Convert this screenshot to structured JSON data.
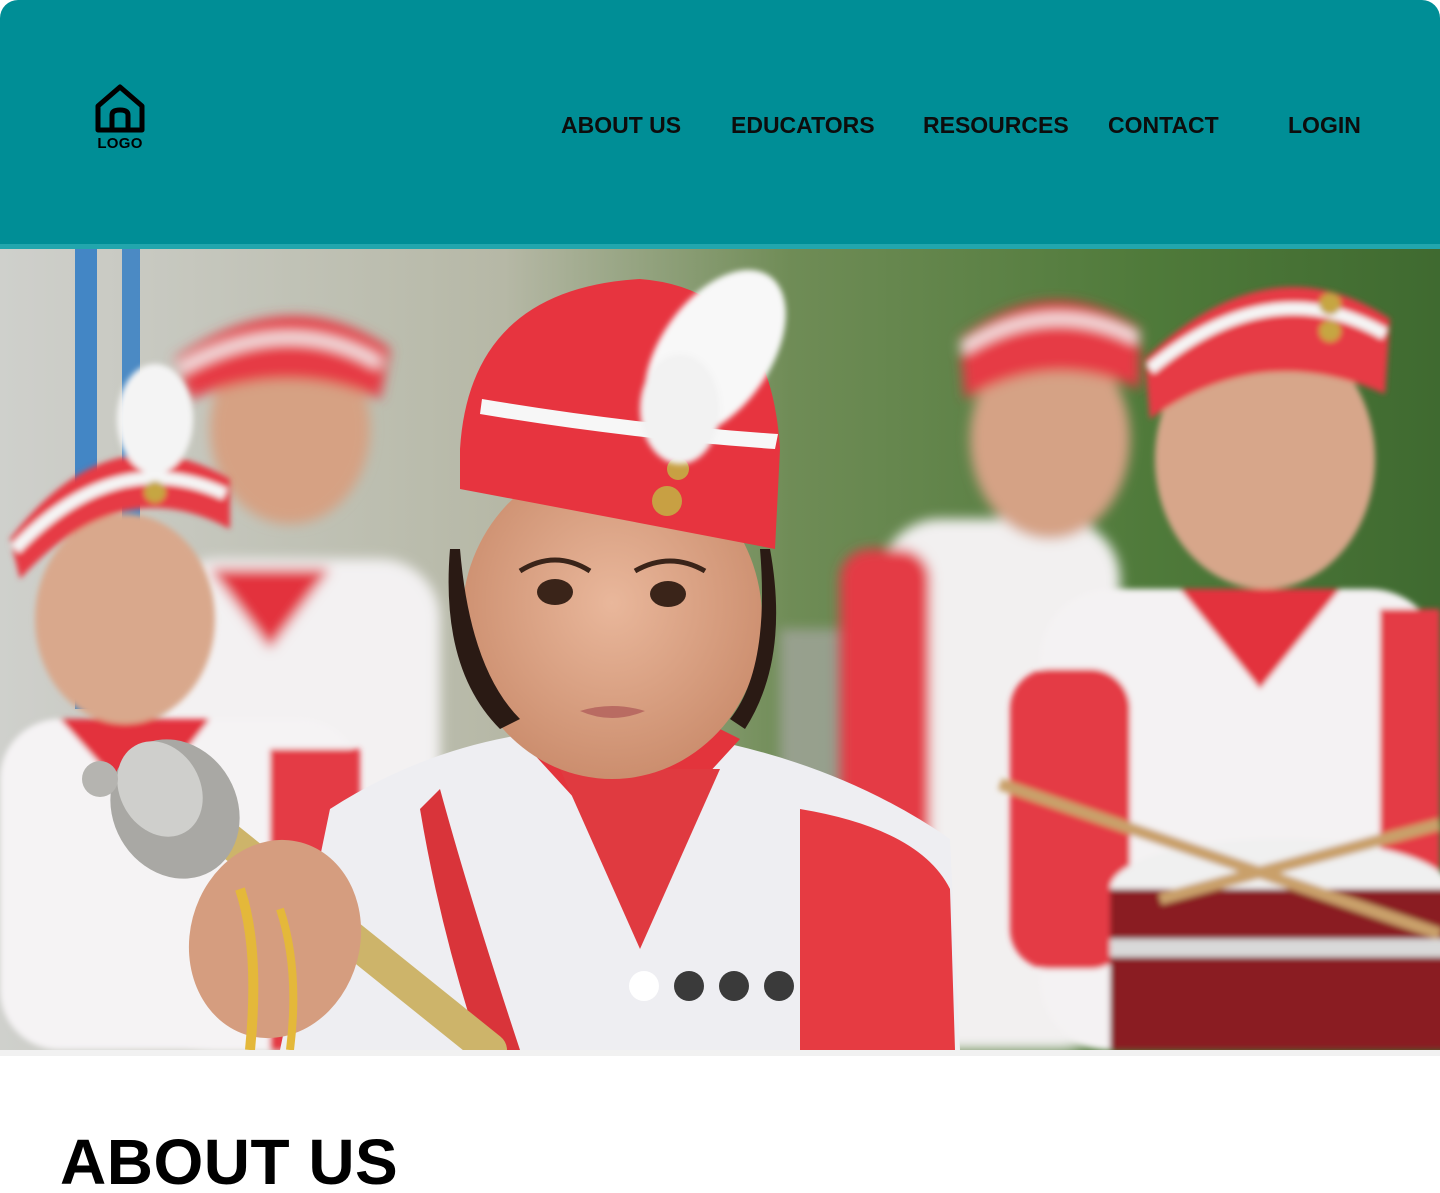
{
  "header": {
    "logo_label": "LOGO",
    "logo_icon": "home-icon",
    "background_color": "#008e96",
    "nav": [
      {
        "label": "ABOUT US"
      },
      {
        "label": "EDUCATORS"
      },
      {
        "label": "RESOURCES"
      },
      {
        "label": "CONTACT"
      },
      {
        "label": "LOGIN"
      }
    ]
  },
  "hero": {
    "image_alt": "Children in red and white marching band uniforms",
    "slides_count": 4,
    "active_slide": 1
  },
  "about": {
    "title": "ABOUT US"
  }
}
